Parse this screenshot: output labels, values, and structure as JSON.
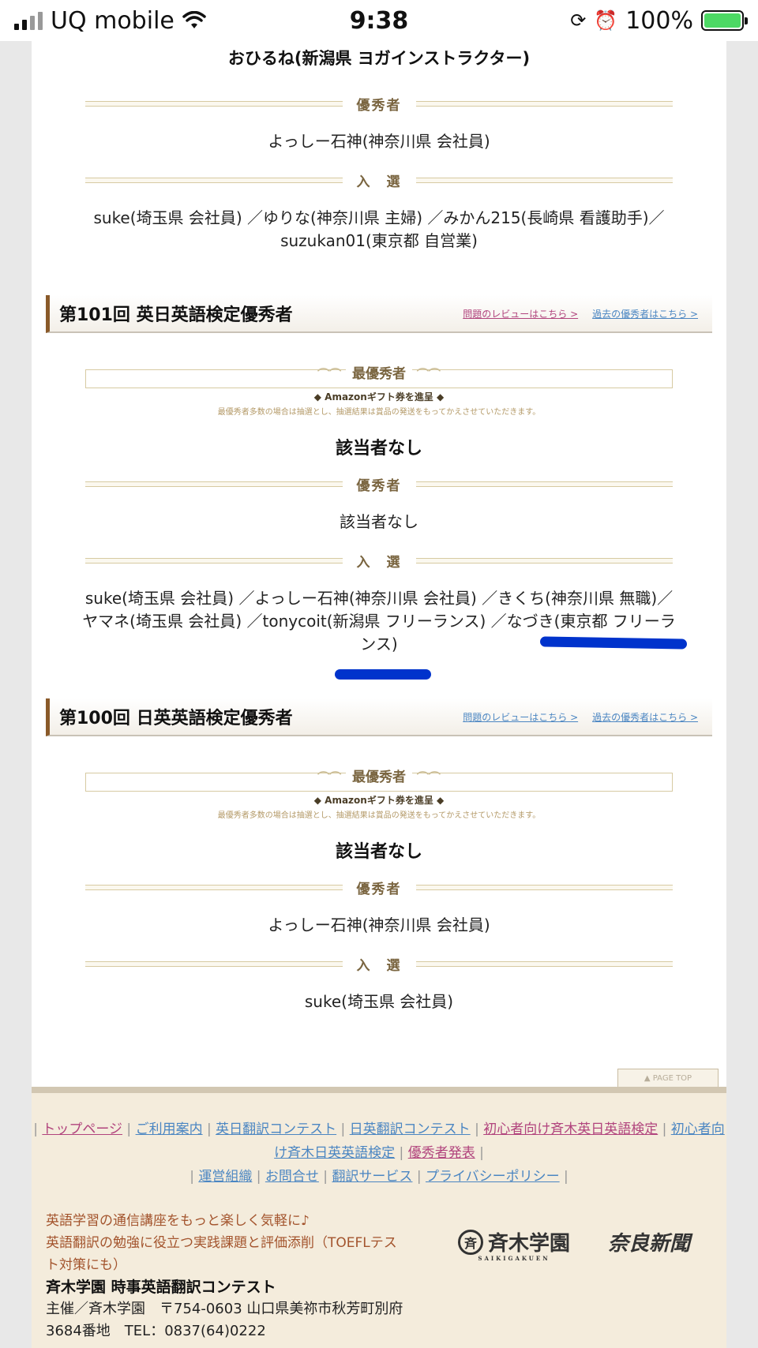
{
  "status_bar": {
    "carrier": "UQ mobile",
    "time": "9:38",
    "battery": "100%"
  },
  "top_section": {
    "name": "おひるね(新潟県 ヨガインストラクター)",
    "excellent_label": "優秀者",
    "excellent": "よっしー石神(神奈川県 会社員)",
    "selected_label": "入　選",
    "selected": "suke(埼玉県 会社員) ／ゆりな(神奈川県 主婦) ／みかん215(長崎県 看護助手)／suzukan01(東京都 自営業)"
  },
  "contest101": {
    "title": "第101回 英日英語検定優秀者",
    "review_link": "問題のレビューはこちら >",
    "past_link": "過去の優秀者はこちら >",
    "top_label": "最優秀者",
    "gift": "Amazonギフト券を進呈",
    "note": "最優秀者多数の場合は抽選とし、抽選結果は賞品の発送をもってかえさせていただきます。",
    "top_winner": "該当者なし",
    "excellent_label": "優秀者",
    "excellent": "該当者なし",
    "selected_label": "入　選",
    "selected": "suke(埼玉県 会社員) ／よっしー石神(神奈川県 会社員) ／きくち(神奈川県 無職)／ヤマネ(埼玉県 会社員) ／tonycoit(新潟県 フリーランス) ／なづき(東京都 フリーランス)"
  },
  "contest100": {
    "title": "第100回 日英英語検定優秀者",
    "review_link": "問題のレビューはこちら >",
    "past_link": "過去の優秀者はこちら >",
    "top_label": "最優秀者",
    "gift": "Amazonギフト券を進呈",
    "note": "最優秀者多数の場合は抽選とし、抽選結果は賞品の発送をもってかえさせていただきます。",
    "top_winner": "該当者なし",
    "excellent_label": "優秀者",
    "excellent": "よっしー石神(神奈川県 会社員)",
    "selected_label": "入　選",
    "selected": "suke(埼玉県 会社員)"
  },
  "page_top": "▲ PAGE TOP",
  "footer": {
    "nav": [
      "トップページ",
      "ご利用案内",
      "英日翻訳コンテスト",
      "日英翻訳コンテスト",
      "初心者向け斉木英日英語検定",
      "初心者向け斉木日英英語検定",
      "優秀者発表",
      "運営組織",
      "お問合せ",
      "翻訳サービス",
      "プライバシーポリシー"
    ],
    "tagline1": "英語学習の通信講座をもっと楽しく気軽に♪",
    "tagline2": "英語翻訳の勉強に役立つ実践課題と評価添削（TOEFLテスト対策にも）",
    "name": "斉木学園 時事英語翻訳コンテスト",
    "address": "主催／斉木学園　〒754-0603 山口県美祢市秋芳町別府3684番地　TEL：0837(64)0222",
    "logo1": "斉木学園",
    "logo1_sub": "SAIKIGAKUEN",
    "logo2": "奈良新聞"
  }
}
